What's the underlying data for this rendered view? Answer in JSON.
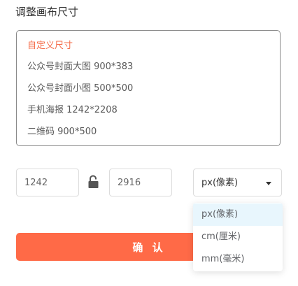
{
  "dialog": {
    "title": "调整画布尺寸"
  },
  "presets": [
    {
      "label": "自定义尺寸",
      "active": true
    },
    {
      "label": "公众号封面大图 900*383",
      "active": false
    },
    {
      "label": "公众号封面小图 500*500",
      "active": false
    },
    {
      "label": "手机海报 1242*2208",
      "active": false
    },
    {
      "label": "二维码 900*500",
      "active": false
    }
  ],
  "size": {
    "width": "1242",
    "height": "2916",
    "lock_icon": "unlocked-padlock-icon"
  },
  "unit": {
    "selected": "px(像素)",
    "options": [
      "px(像素)",
      "cm(厘米)",
      "mm(毫米)"
    ]
  },
  "confirm_label": "确 认",
  "colors": {
    "accent": "#ff6a47",
    "active_text": "#f56c4a",
    "option_hover": "#e8f6fd"
  }
}
